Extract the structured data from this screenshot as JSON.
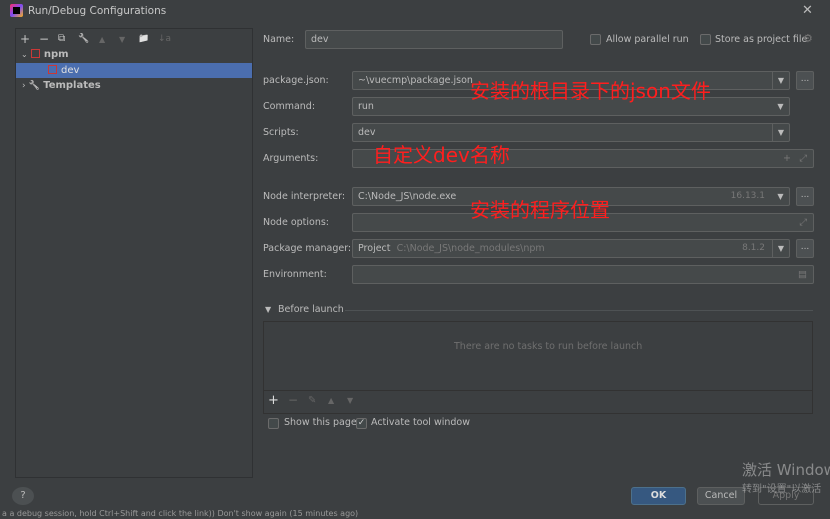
{
  "window": {
    "title": "Run/Debug Configurations",
    "close": "✕"
  },
  "toolbar": {
    "add": "+",
    "remove": "−",
    "copy": "⧉",
    "edit": "🔧",
    "up": "▲",
    "down": "▼",
    "folder": "📁",
    "sort": "↓a"
  },
  "tree": {
    "npm": "npm",
    "dev": "dev",
    "templates": "Templates"
  },
  "form": {
    "name_label": "Name:",
    "name_value": "dev",
    "allow_parallel": "Allow parallel run",
    "store_project": "Store as project file",
    "package_json_label": "package.json:",
    "package_json_value": "~\\vuecmp\\package.json",
    "command_label": "Command:",
    "command_value": "run",
    "scripts_label": "Scripts:",
    "scripts_value": "dev",
    "arguments_label": "Arguments:",
    "arguments_value": "",
    "node_interpreter_label": "Node interpreter:",
    "node_interpreter_value": "C:\\Node_JS\\node.exe",
    "node_version": "16.13.1",
    "node_options_label": "Node options:",
    "node_options_value": "",
    "package_manager_label": "Package manager:",
    "package_manager_value": "Project",
    "package_manager_path": "C:\\Node_JS\\node_modules\\npm",
    "package_manager_version": "8.1.2",
    "environment_label": "Environment:",
    "environment_value": ""
  },
  "before_launch": {
    "title": "Before launch",
    "empty": "There are no tasks to run before launch",
    "show_page": "Show this page",
    "show_page_checked": false,
    "activate_tool": "Activate tool window",
    "activate_tool_checked": true
  },
  "annotations": {
    "a1": "安装的根目录下的json文件",
    "a2": "自定义dev名称",
    "a3": "安装的程序位置"
  },
  "buttons": {
    "help": "?",
    "ok": "OK",
    "cancel": "Cancel",
    "apply": "Apply"
  },
  "watermark": {
    "line1": "激活 Windows",
    "line2": "转到\"设置\"以激活"
  },
  "statusbar": {
    "left": "a a debug session, hold Ctrl+Shift and click the link)) Don't show again (15 minutes ago)"
  },
  "colors": {
    "accent": "#4b6eaf",
    "ok": "#365880",
    "annotation": "#ff1e1e"
  }
}
